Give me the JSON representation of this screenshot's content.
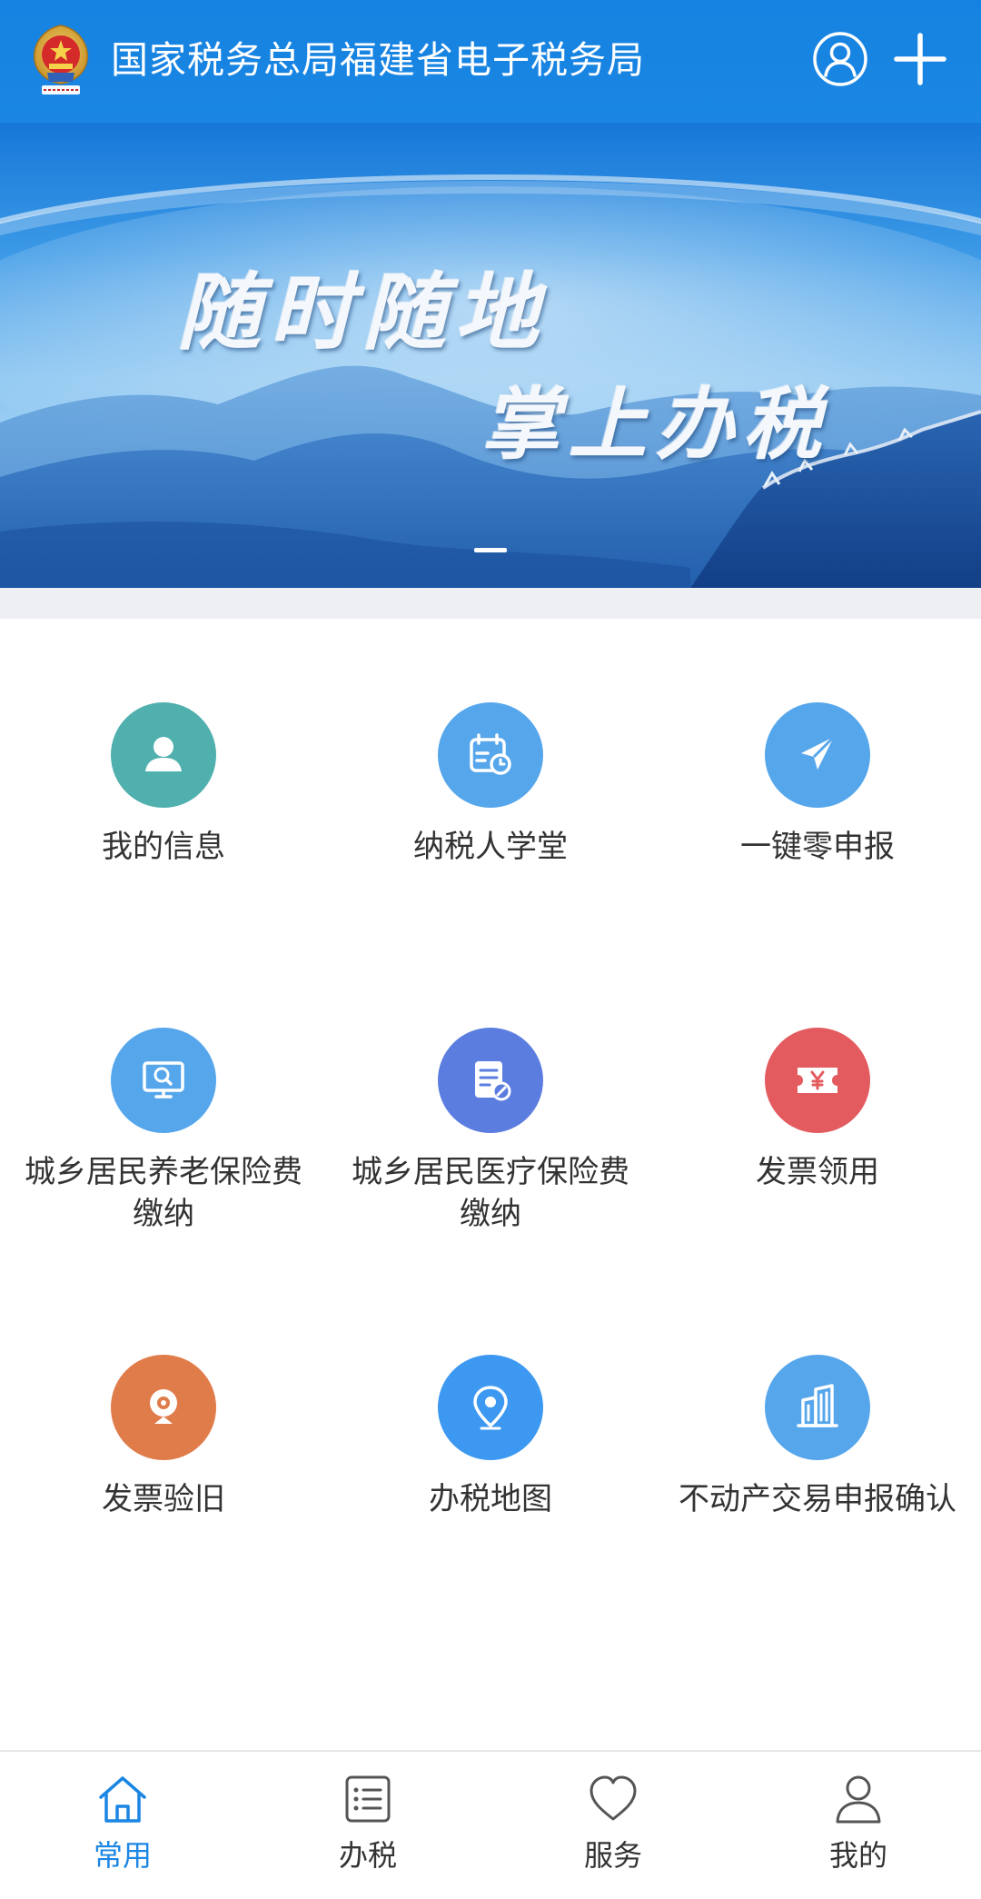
{
  "header": {
    "title": "国家税务总局福建省电子税务局",
    "emblem_icon": "tax-bureau-emblem-icon",
    "user_icon": "user-circle-icon",
    "add_icon": "plus-icon",
    "color": "#1b86e3"
  },
  "banner": {
    "line1": "随时随地",
    "line2": "掌上办税",
    "slides_total": 1,
    "active_slide": 1
  },
  "services": [
    {
      "id": "my-info",
      "label": "我的信息",
      "icon": "user-icon",
      "color": "#4fb0ae"
    },
    {
      "id": "taxpayer-school",
      "label": "纳税人学堂",
      "icon": "calendar-clock-icon",
      "color": "#56a6ec"
    },
    {
      "id": "zero-declaration",
      "label": "一键零申报",
      "icon": "paper-plane-icon",
      "color": "#56a6ec"
    },
    {
      "id": "pension-insurance",
      "label": "城乡居民养老保险费缴纳",
      "icon": "monitor-search-icon",
      "color": "#56a6ec"
    },
    {
      "id": "medical-insurance",
      "label": "城乡居民医疗保险费缴纳",
      "icon": "document-edit-icon",
      "color": "#5b7de0"
    },
    {
      "id": "invoice-collect",
      "label": "发票领用",
      "icon": "ticket-yuan-icon",
      "color": "#e35b5f"
    },
    {
      "id": "invoice-verify",
      "label": "发票验旧",
      "icon": "webcam-icon",
      "color": "#e07c4a"
    },
    {
      "id": "tax-map",
      "label": "办税地图",
      "icon": "map-pin-icon",
      "color": "#3c98f0"
    },
    {
      "id": "real-estate",
      "label": "不动产交易申报确认",
      "icon": "buildings-icon",
      "color": "#56a6ec"
    }
  ],
  "tabbar": {
    "active": "常用",
    "active_color": "#1b86e3",
    "tabs": [
      {
        "label": "常用",
        "icon": "home-icon"
      },
      {
        "label": "办税",
        "icon": "list-icon"
      },
      {
        "label": "服务",
        "icon": "heart-icon"
      },
      {
        "label": "我的",
        "icon": "person-icon"
      }
    ]
  }
}
